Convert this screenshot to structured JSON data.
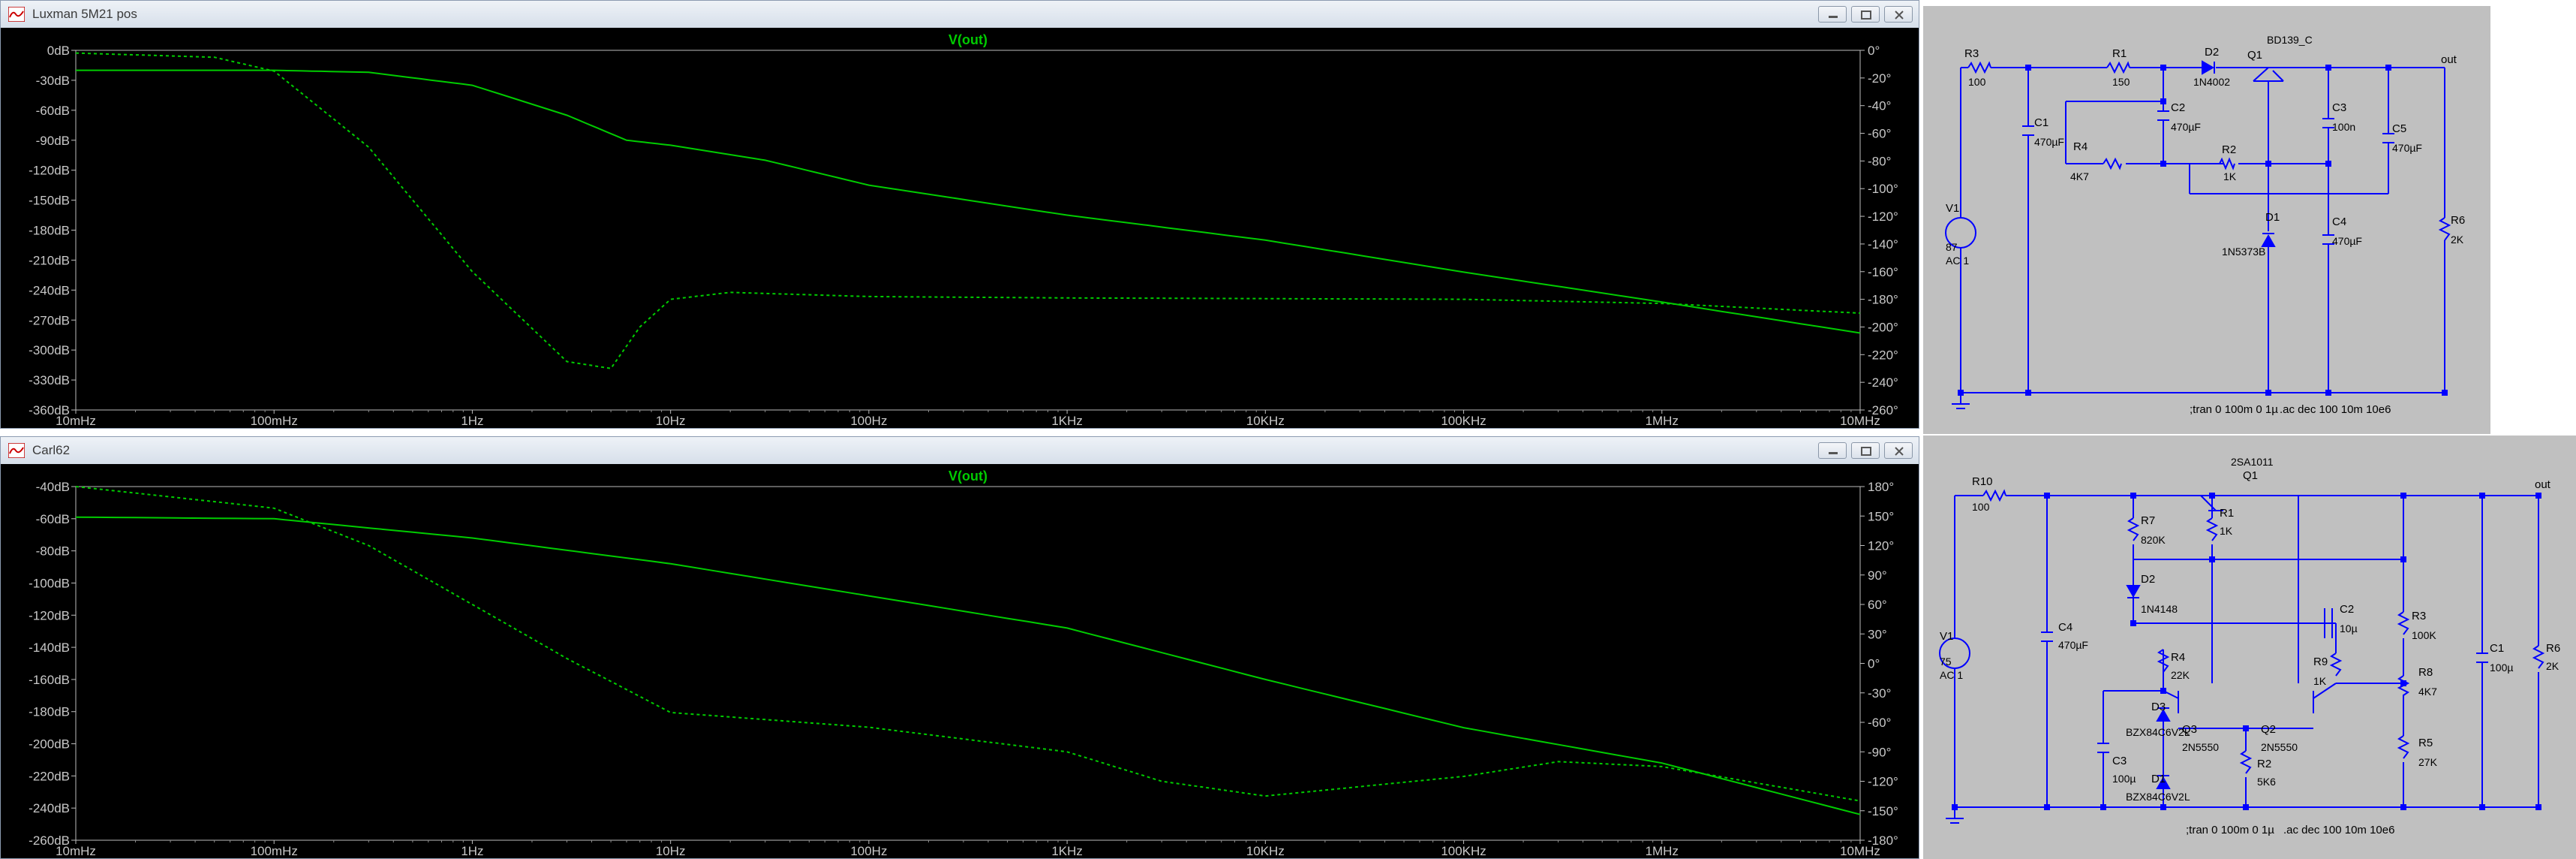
{
  "windows": [
    {
      "title": "Luxman 5M21 pos",
      "trace_label": "V(out)",
      "left_ticks": [
        "0dB",
        "-30dB",
        "-60dB",
        "-90dB",
        "-120dB",
        "-150dB",
        "-180dB",
        "-210dB",
        "-240dB",
        "-270dB",
        "-300dB",
        "-330dB",
        "-360dB"
      ],
      "right_ticks": [
        "0°",
        "-20°",
        "-40°",
        "-60°",
        "-80°",
        "-100°",
        "-120°",
        "-140°",
        "-160°",
        "-180°",
        "-200°",
        "-220°",
        "-240°",
        "-260°"
      ],
      "x_ticks": [
        "10mHz",
        "100mHz",
        "1Hz",
        "10Hz",
        "100Hz",
        "1KHz",
        "10KHz",
        "100KHz",
        "1MHz",
        "10MHz"
      ]
    },
    {
      "title": "Carl62",
      "trace_label": "V(out)",
      "left_ticks": [
        "-40dB",
        "-60dB",
        "-80dB",
        "-100dB",
        "-120dB",
        "-140dB",
        "-160dB",
        "-180dB",
        "-200dB",
        "-220dB",
        "-240dB",
        "-260dB"
      ],
      "right_ticks": [
        "180°",
        "150°",
        "120°",
        "90°",
        "60°",
        "30°",
        "0°",
        "-30°",
        "-60°",
        "-90°",
        "-120°",
        "-150°",
        "-180°"
      ],
      "x_ticks": [
        "10mHz",
        "100mHz",
        "1Hz",
        "10Hz",
        "100Hz",
        "1KHz",
        "10KHz",
        "100KHz",
        "1MHz",
        "10MHz"
      ]
    }
  ],
  "chart_data": [
    {
      "type": "line",
      "x_scale": "log",
      "xlim": [
        "10mHz",
        "10MHz"
      ],
      "ylim_left": [
        -360,
        0
      ],
      "ylim_right": [
        -260,
        0
      ],
      "series": [
        {
          "name": "V(out)",
          "style": "solid",
          "axis": "magnitude_dB",
          "x": [
            0.01,
            0.1,
            0.3,
            1,
            3,
            6,
            10,
            30,
            100,
            1000,
            10000,
            100000,
            1000000,
            10000000
          ],
          "y": [
            -20,
            -20,
            -22,
            -35,
            -65,
            -90,
            -95,
            -110,
            -135,
            -165,
            -190,
            -222,
            -252,
            -283
          ]
        },
        {
          "name": "V(out)",
          "style": "dashed",
          "axis": "phase_deg",
          "x": [
            0.01,
            0.05,
            0.1,
            0.3,
            1,
            3,
            5,
            7,
            10,
            20,
            100,
            1000,
            100000,
            1000000,
            10000000
          ],
          "y": [
            -2,
            -5,
            -15,
            -70,
            -160,
            -225,
            -230,
            -200,
            -180,
            -175,
            -178,
            -179,
            -180,
            -183,
            -190
          ]
        }
      ]
    },
    {
      "type": "line",
      "x_scale": "log",
      "xlim": [
        "10mHz",
        "10MHz"
      ],
      "ylim_left": [
        -260,
        -40
      ],
      "ylim_right": [
        -180,
        180
      ],
      "series": [
        {
          "name": "V(out)",
          "style": "solid",
          "axis": "magnitude_dB",
          "x": [
            0.01,
            0.1,
            1,
            10,
            100,
            1000,
            10000,
            100000,
            1000000,
            10000000
          ],
          "y": [
            -59,
            -60,
            -72,
            -88,
            -108,
            -128,
            -160,
            -190,
            -212,
            -244
          ]
        },
        {
          "name": "V(out)",
          "style": "dashed",
          "axis": "phase_deg",
          "x": [
            0.01,
            0.1,
            0.3,
            1,
            3,
            10,
            100,
            1000,
            3000,
            10000,
            100000,
            300000,
            1000000,
            10000000
          ],
          "y": [
            180,
            158,
            120,
            60,
            5,
            -50,
            -65,
            -90,
            -120,
            -135,
            -115,
            -100,
            -105,
            -140
          ]
        }
      ]
    }
  ],
  "schematics": [
    {
      "labels": [
        "R3",
        "100",
        "C1",
        "470µF",
        "R1",
        "150",
        "D2",
        "1N4002",
        "Q1",
        "BD139_C",
        "out",
        "C2",
        "470µF",
        "R4",
        "4K7",
        "R2",
        "1K",
        "C3",
        "100n",
        "C5",
        "470µF",
        "V1",
        "87",
        "AC 1",
        "D1",
        "1N5373B",
        "C4",
        "470µF",
        "R6",
        "2K",
        ";tran 0 100m 0 1µ",
        ".ac dec 100 10m 10e6"
      ]
    },
    {
      "labels": [
        "R10",
        "100",
        "R7",
        "820K",
        "R1",
        "1K",
        "2SA1011",
        "Q1",
        "out",
        "D2",
        "1N4148",
        "C2",
        "10µ",
        "R3",
        "100K",
        "V1",
        "75",
        "AC 1",
        "C4",
        "470µF",
        "R4",
        "22K",
        "Q3",
        "2N5550",
        "Q2",
        "2N5550",
        "R9",
        "1K",
        "R8",
        "4K7",
        "C1",
        "100µ",
        "R6",
        "2K",
        "D3",
        "BZX84C6V2L",
        "C3",
        "100µ",
        "D1",
        "BZX84C6V2L",
        "R2",
        "5K6",
        "R5",
        "27K",
        ";tran 0 100m 0 1µ",
        ".ac dec 100 10m 10e6"
      ]
    }
  ],
  "colors": {
    "trace": "#00cc00",
    "axis_text": "#c8c8c8",
    "plot_bg": "#000000",
    "grid": "#3a3a3a",
    "wire": "#0000ff",
    "schematic_bg": "#c0c0c0"
  }
}
